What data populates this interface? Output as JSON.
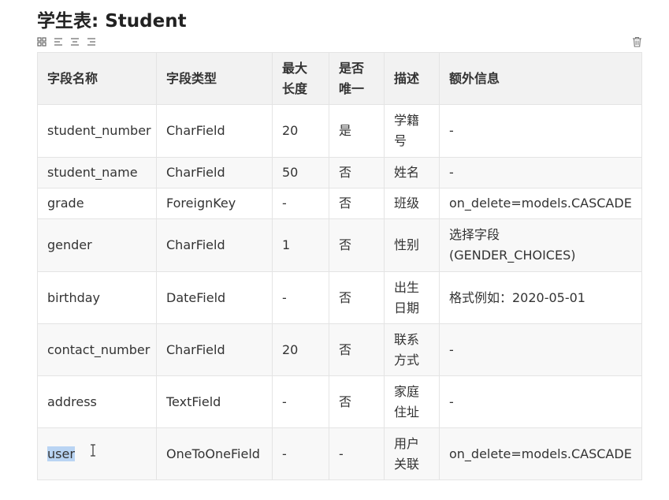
{
  "title": "学生表: Student",
  "toolbar": {
    "icons": [
      "grid-icon",
      "align-left-icon",
      "align-center-icon",
      "align-right-icon"
    ],
    "delete_icon": "trash-icon"
  },
  "table": {
    "headers": [
      "字段名称",
      "字段类型",
      "最大长度",
      "是否唯一",
      "描述",
      "额外信息"
    ],
    "rows": [
      [
        "student_number",
        "CharField",
        "20",
        "是",
        "学籍号",
        "-"
      ],
      [
        "student_name",
        "CharField",
        "50",
        "否",
        "姓名",
        "-"
      ],
      [
        "grade",
        "ForeignKey",
        "-",
        "否",
        "班级",
        "on_delete=models.CASCADE"
      ],
      [
        "gender",
        "CharField",
        "1",
        "否",
        "性别",
        "选择字段(GENDER_CHOICES)"
      ],
      [
        "birthday",
        "DateField",
        "-",
        "否",
        "出生日期",
        "格式例如：2020-05-01"
      ],
      [
        "contact_number",
        "CharField",
        "20",
        "否",
        "联系方式",
        "-"
      ],
      [
        "address",
        "TextField",
        "-",
        "否",
        "家庭住址",
        "-"
      ],
      [
        "user",
        "OneToOneField",
        "-",
        "-",
        "用户关联",
        "on_delete=models.CASCADE"
      ]
    ]
  }
}
